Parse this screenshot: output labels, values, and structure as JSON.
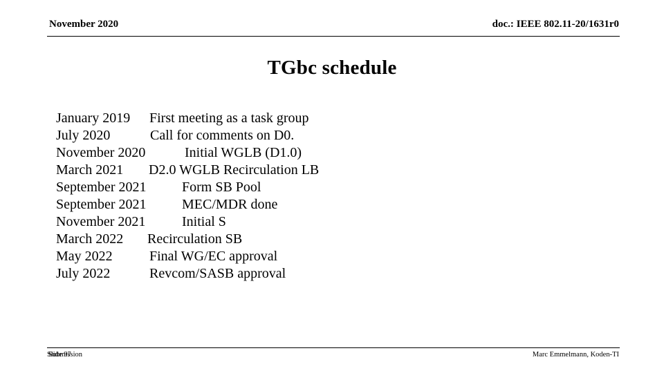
{
  "header": {
    "date": "November 2020",
    "doc_id": "doc.: IEEE 802.11-20/1631r0"
  },
  "title": "TGbc schedule",
  "schedule": {
    "rows": [
      {
        "date": "January 2019",
        "desc": "First meeting as a task group",
        "indent": 135
      },
      {
        "date": "July 2020",
        "desc": "Call for comments on D0.",
        "indent": 136
      },
      {
        "date": "November 2020",
        "desc": "Initial WGLB (D1.0)",
        "indent": 186
      },
      {
        "date": "March 2021",
        "desc": "D2.0 WGLB Recirculation LB",
        "indent": 134
      },
      {
        "date": "September 2021",
        "desc": "Form SB Pool",
        "indent": 182
      },
      {
        "date": "September 2021",
        "desc": "MEC/MDR done",
        "indent": 182
      },
      {
        "date": "November 2021",
        "desc": "Initial S",
        "indent": 182
      },
      {
        "date": "March 2022",
        "desc": "Recirculation SB",
        "indent": 132
      },
      {
        "date": "May 2022",
        "desc": "Final WG/EC approval",
        "indent": 135
      },
      {
        "date": "July 2022",
        "desc": "Revcom/SASB approval",
        "indent": 135
      }
    ]
  },
  "footer": {
    "left": "Submission",
    "center": "Slide 97",
    "right": "Marc Emmelmann, Koden-TI"
  }
}
